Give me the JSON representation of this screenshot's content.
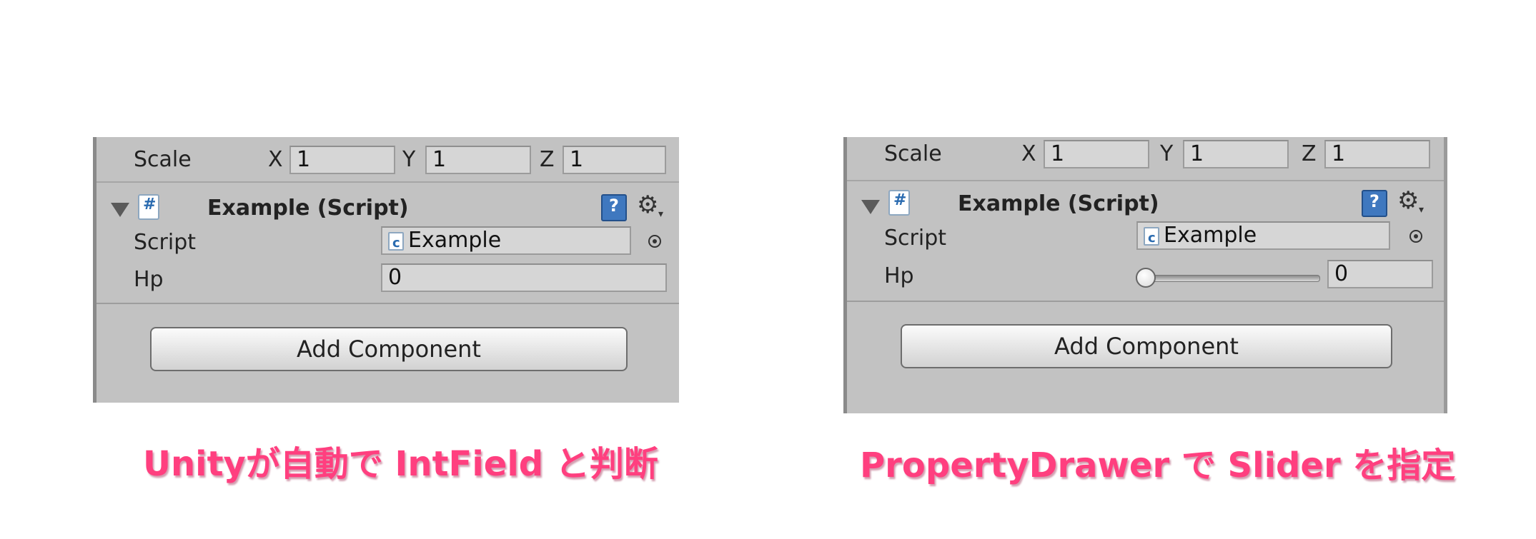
{
  "left": {
    "scale_label": "Scale",
    "x_label": "X",
    "x_value": "1",
    "y_label": "Y",
    "y_value": "1",
    "z_label": "Z",
    "z_value": "1",
    "component_title": "Example (Script)",
    "script_label": "Script",
    "script_value": "Example",
    "hp_label": "Hp",
    "hp_value": "0",
    "add_component": "Add Component",
    "caption": "Unityが自動で IntField と判断"
  },
  "right": {
    "scale_label": "Scale",
    "x_label": "X",
    "x_value": "1",
    "y_label": "Y",
    "y_value": "1",
    "z_label": "Z",
    "z_value": "1",
    "component_title": "Example (Script)",
    "script_label": "Script",
    "script_value": "Example",
    "hp_label": "Hp",
    "hp_value": "0",
    "hp_slider_fraction": 0,
    "add_component": "Add Component",
    "caption": "PropertyDrawer で Slider を指定"
  },
  "icons": [
    "foldout-arrow-icon",
    "csharp-script-icon",
    "help-book-icon",
    "gear-icon",
    "object-picker-icon"
  ],
  "colors": {
    "panel": "#c2c2c2",
    "caption": "#ff3f7f"
  }
}
